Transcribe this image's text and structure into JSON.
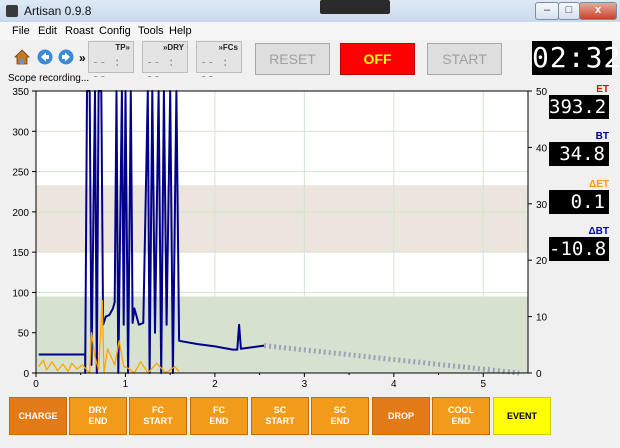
{
  "window": {
    "title": "Artisan 0.9.8",
    "minimize": "–",
    "maximize": "□",
    "close": "x"
  },
  "menu": [
    "File",
    "Edit",
    "Roast",
    "Config",
    "Tools",
    "Help"
  ],
  "toolbar": {
    "icons": [
      "home-icon",
      "back-arrow-icon",
      "forward-arrow-icon"
    ],
    "more": "»",
    "lcds": [
      {
        "label": "TP»",
        "value": "-- : --"
      },
      {
        "label": "»DRY",
        "value": "-- : --"
      },
      {
        "label": "»FCs",
        "value": "-- : --"
      }
    ],
    "reset": "RESET",
    "off": "OFF",
    "start": "START",
    "timer": "02:32"
  },
  "status": "Scope recording...",
  "readouts": [
    {
      "label": "ET",
      "value": "393.2",
      "color": "#ff0000"
    },
    {
      "label": "BT",
      "value": "34.8",
      "color": "#00008b"
    },
    {
      "label": "ΔET",
      "value": "0.1",
      "color": "#ff9900"
    },
    {
      "label": "ΔBT",
      "value": "-10.8",
      "color": "#0000cd"
    }
  ],
  "events": [
    {
      "label": "CHARGE",
      "style": "dark"
    },
    {
      "label": "DRY\nEND",
      "style": "light"
    },
    {
      "label": "FC\nSTART",
      "style": "light"
    },
    {
      "label": "FC\nEND",
      "style": "light"
    },
    {
      "label": "SC\nSTART",
      "style": "light"
    },
    {
      "label": "SC\nEND",
      "style": "light"
    },
    {
      "label": "DROP",
      "style": "dark"
    },
    {
      "label": "COOL\nEND",
      "style": "light"
    },
    {
      "label": "EVENT",
      "style": "yellow"
    }
  ],
  "chart_data": {
    "type": "line",
    "x": {
      "ticks": [
        "0",
        "1",
        "2",
        "3",
        "4",
        "5"
      ],
      "range": [
        0,
        5.5
      ]
    },
    "y_left": {
      "ticks": [
        "0",
        "50",
        "100",
        "150",
        "200",
        "250",
        "300",
        "350"
      ],
      "range": [
        0,
        350
      ]
    },
    "y_right": {
      "ticks": [
        "0",
        "10",
        "20",
        "30",
        "40",
        "50"
      ],
      "range": [
        0,
        50
      ]
    },
    "phases": [
      {
        "range": [
          0,
          95
        ],
        "color": "#d6e2cf"
      },
      {
        "range": [
          150,
          233
        ],
        "color": "#ece5dd"
      }
    ],
    "series": [
      {
        "color": "#00008b",
        "points": [
          [
            0.03,
            23
          ],
          [
            0.55,
            23
          ],
          [
            0.55,
            0
          ],
          [
            0.57,
            350
          ],
          [
            0.6,
            350
          ],
          [
            0.62,
            10
          ],
          [
            0.66,
            350
          ],
          [
            0.68,
            0
          ],
          [
            0.7,
            350
          ],
          [
            0.73,
            350
          ],
          [
            0.75,
            60
          ],
          [
            0.78,
            70
          ],
          [
            0.82,
            72
          ],
          [
            0.86,
            80
          ],
          [
            0.88,
            88
          ],
          [
            0.9,
            350
          ],
          [
            0.92,
            0
          ],
          [
            0.96,
            350
          ],
          [
            0.98,
            60
          ],
          [
            1.0,
            350
          ],
          [
            1.03,
            0
          ],
          [
            1.06,
            350
          ],
          [
            1.08,
            62
          ],
          [
            1.1,
            80
          ],
          [
            1.15,
            60
          ],
          [
            1.2,
            62
          ],
          [
            1.25,
            350
          ],
          [
            1.27,
            0
          ],
          [
            1.3,
            350
          ],
          [
            1.33,
            50
          ],
          [
            1.37,
            350
          ],
          [
            1.4,
            0
          ],
          [
            1.43,
            350
          ],
          [
            1.46,
            60
          ],
          [
            1.5,
            350
          ],
          [
            1.53,
            0
          ],
          [
            1.57,
            350
          ],
          [
            1.6,
            40
          ],
          [
            1.8,
            36
          ],
          [
            2.0,
            33
          ],
          [
            2.2,
            29
          ],
          [
            2.25,
            29
          ],
          [
            2.27,
            60
          ],
          [
            2.29,
            30
          ],
          [
            2.55,
            34
          ]
        ]
      },
      {
        "color": "#ffa500",
        "points": [
          [
            0.03,
            8
          ],
          [
            0.08,
            16
          ],
          [
            0.12,
            4
          ],
          [
            0.18,
            14
          ],
          [
            0.24,
            3
          ],
          [
            0.3,
            11
          ],
          [
            0.36,
            2
          ],
          [
            0.4,
            12
          ],
          [
            0.46,
            5
          ],
          [
            0.52,
            10
          ],
          [
            0.6,
            0
          ],
          [
            0.62,
            50
          ],
          [
            0.66,
            20
          ],
          [
            0.7,
            4
          ],
          [
            0.74,
            90
          ],
          [
            0.76,
            0
          ],
          [
            0.8,
            30
          ],
          [
            0.88,
            10
          ],
          [
            0.93,
            40
          ],
          [
            0.98,
            8
          ],
          [
            1.03,
            6
          ],
          [
            1.1,
            0
          ],
          [
            1.17,
            14
          ],
          [
            1.25,
            0
          ],
          [
            1.35,
            12
          ],
          [
            1.45,
            0
          ],
          [
            1.55,
            8
          ],
          [
            1.6,
            2
          ]
        ]
      }
    ],
    "projection": {
      "color": "#9aa3b8",
      "from": [
        2.55,
        34
      ],
      "to": [
        5.4,
        0
      ]
    }
  }
}
